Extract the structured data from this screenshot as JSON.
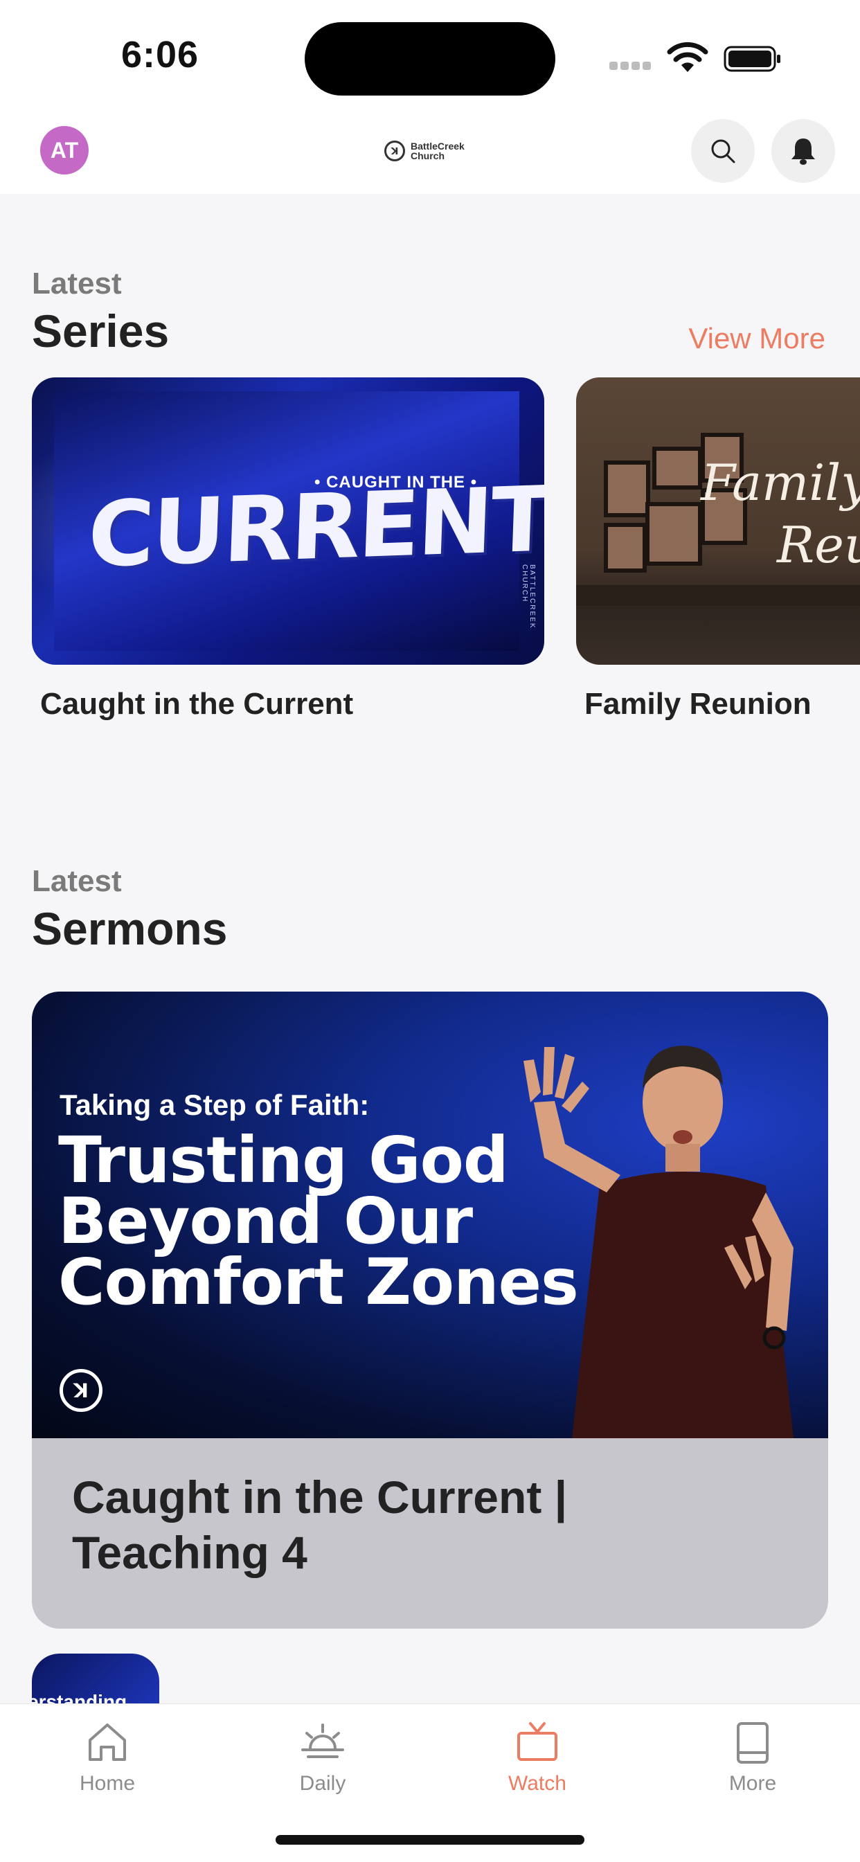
{
  "status_bar": {
    "time": "6:06"
  },
  "header": {
    "avatar_initials": "AT",
    "logo_text_line1": "BattleCreek",
    "logo_text_line2": "Church",
    "search_icon": "search-icon",
    "bell_icon": "bell-icon"
  },
  "series_section": {
    "kicker": "Latest",
    "title": "Series",
    "view_more": "View More",
    "items": [
      {
        "label": "Caught in the Current",
        "art_big": "CURRENT",
        "art_small": "• CAUGHT IN THE •",
        "art_vertical": "BATTLECREEK CHURCH"
      },
      {
        "label": "Family Reunion",
        "art_script1": "Family",
        "art_script2": "Reu"
      }
    ]
  },
  "sermons_section": {
    "kicker": "Latest",
    "title": "Sermons",
    "featured": {
      "hero_subtitle": "Taking a Step of Faith:",
      "hero_title_line1": "Trusting God",
      "hero_title_line2": "Beyond Our",
      "hero_title_line3": "Comfort Zones",
      "title": "Caught in the Current | Teaching 4"
    },
    "peek_text": "erstanding"
  },
  "tabbar": {
    "tabs": [
      {
        "label": "Home",
        "icon": "home-icon"
      },
      {
        "label": "Daily",
        "icon": "sunrise-icon"
      },
      {
        "label": "Watch",
        "icon": "tv-icon",
        "active": true
      },
      {
        "label": "More",
        "icon": "book-icon"
      }
    ]
  },
  "colors": {
    "accent": "#ec7c62",
    "avatar": "#c469c6"
  }
}
